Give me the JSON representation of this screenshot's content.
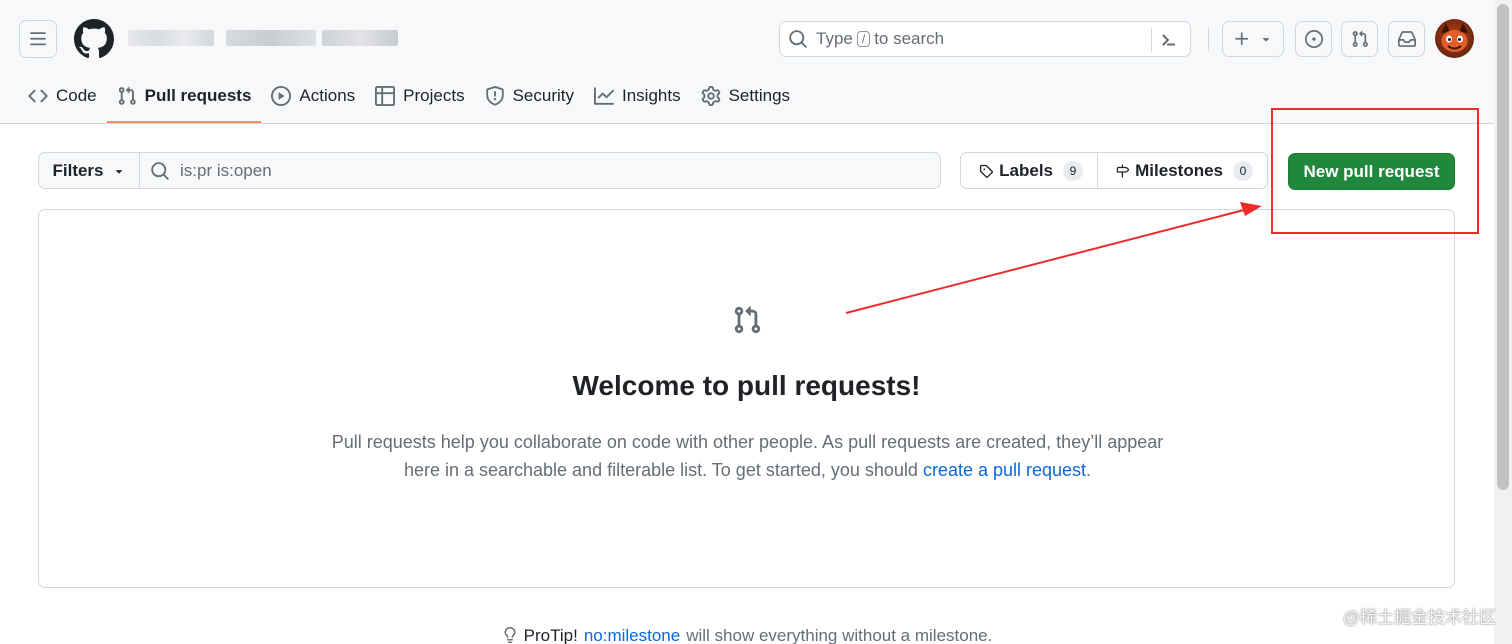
{
  "header": {
    "menu_icon": "hamburger-icon",
    "logo_icon": "github-logo-icon",
    "search": {
      "prefix": "Type",
      "key": "/",
      "suffix": "to search"
    },
    "command_icon": "command-palette-icon",
    "create_icon": "plus-icon",
    "issues_icon": "issue-opened-icon",
    "pulls_icon": "git-pull-request-icon",
    "inbox_icon": "inbox-icon",
    "avatar_icon": "user-avatar"
  },
  "tabs": [
    {
      "label": "Code",
      "icon": "code-icon",
      "active": false
    },
    {
      "label": "Pull requests",
      "icon": "git-pull-request-icon",
      "active": true
    },
    {
      "label": "Actions",
      "icon": "play-icon",
      "active": false
    },
    {
      "label": "Projects",
      "icon": "table-icon",
      "active": false
    },
    {
      "label": "Security",
      "icon": "shield-icon",
      "active": false
    },
    {
      "label": "Insights",
      "icon": "graph-icon",
      "active": false
    },
    {
      "label": "Settings",
      "icon": "gear-icon",
      "active": false
    }
  ],
  "filters": {
    "button_label": "Filters",
    "query": "is:pr is:open",
    "labels": {
      "label": "Labels",
      "count": "9"
    },
    "milestones": {
      "label": "Milestones",
      "count": "0"
    },
    "new_pr_label": "New pull request"
  },
  "blankslate": {
    "title": "Welcome to pull requests!",
    "text": "Pull requests help you collaborate on code with other people. As pull requests are created, they’ll appear here in a searchable and filterable list. To get started, you should",
    "link_text": "create a pull request",
    "trailing": "."
  },
  "protip": {
    "label": "ProTip!",
    "link": "no:milestone",
    "text": "will show everything without a milestone."
  },
  "watermark": "@稀土掘金技术社区",
  "colors": {
    "accent_green": "#1f883d",
    "tab_underline": "#fd8c73",
    "link_blue": "#0969da",
    "annotation_red": "#ef2b2b"
  }
}
